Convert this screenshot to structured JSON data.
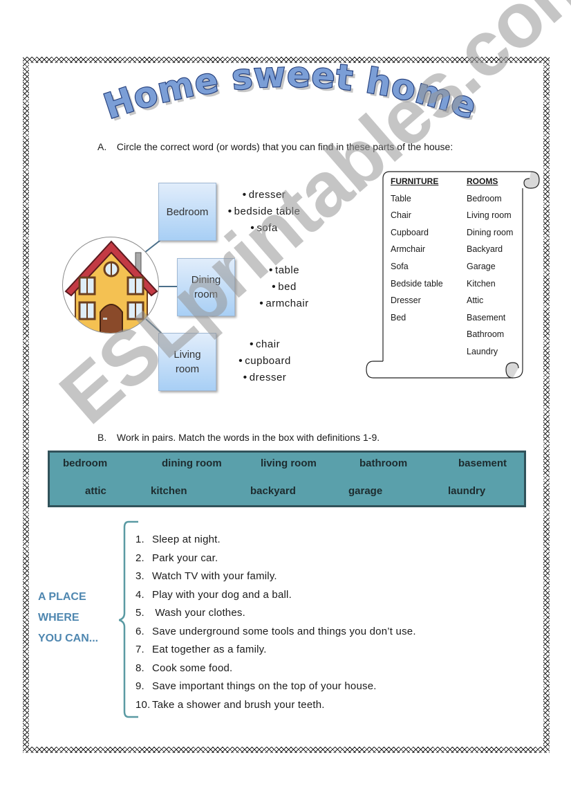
{
  "title": "Home sweet home",
  "section_a": {
    "label": "A.",
    "instruction": "Circle the correct word (or words)  that you can find in these parts of the house:",
    "rooms": [
      {
        "name_line1": "Bedroom",
        "name_line2": "",
        "options": [
          "dresser",
          "bedside table",
          "sofa"
        ]
      },
      {
        "name_line1": "Dining",
        "name_line2": "room",
        "options": [
          "table",
          "bed",
          "armchair"
        ]
      },
      {
        "name_line1": "Living",
        "name_line2": "room",
        "options": [
          "chair",
          "cupboard",
          "dresser"
        ]
      }
    ]
  },
  "scroll_box": {
    "furniture_header": "FURNITURE",
    "rooms_header": "ROOMS",
    "furniture": [
      "Table",
      "Chair",
      "Cupboard",
      "Armchair",
      "Sofa",
      "Bedside table",
      "Dresser",
      "Bed"
    ],
    "rooms": [
      "Bedroom",
      "Living room",
      "Dining room",
      "Backyard",
      "Garage",
      "Kitchen",
      "Attic",
      "Basement",
      "Bathroom",
      "Laundry"
    ]
  },
  "section_b": {
    "label": "B.",
    "instruction": "Work in pairs. Match the words in the box with definitions 1-9.",
    "word_box_row1": [
      "bedroom",
      "dining room",
      "living room",
      "bathroom",
      "basement"
    ],
    "word_box_row2": [
      "attic",
      "kitchen",
      "backyard",
      "garage",
      "laundry"
    ],
    "place_label": [
      "A PLACE",
      "WHERE",
      "YOU CAN..."
    ],
    "definitions": [
      {
        "num": "1.",
        "text": "Sleep at night."
      },
      {
        "num": "2.",
        "text": "Park your car."
      },
      {
        "num": "3.",
        "text": "Watch TV  with your family."
      },
      {
        "num": "4.",
        "text": "Play with your dog and a ball."
      },
      {
        "num": "5.",
        "text": " Wash your clothes."
      },
      {
        "num": "6.",
        "text": "Save underground some tools and things you don’t use."
      },
      {
        "num": "7.",
        "text": "Eat together as a family."
      },
      {
        "num": "8.",
        "text": "Cook some food."
      },
      {
        "num": "9.",
        "text": "Save important things on the top of your house."
      },
      {
        "num": "10.",
        "text": "Take a shower and brush your teeth."
      }
    ]
  },
  "watermark": "ESLprintables.com",
  "colors": {
    "title_fill": "#7b9ed6",
    "title_outline": "#1f3a78",
    "word_box_fill": "#5aa0ab",
    "word_box_border": "#31525a",
    "place_label": "#4f87b0",
    "room_box_top": "#e1edfb",
    "room_box_bottom": "#a8cff5"
  }
}
